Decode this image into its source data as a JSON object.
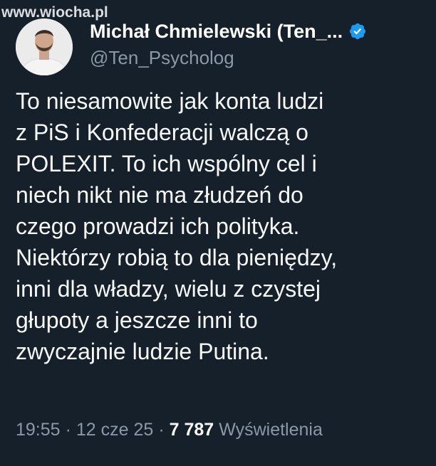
{
  "watermark": "www.wiocha.pl",
  "author": {
    "display_name": "Michał Chmielewski (Ten_...",
    "handle": "@Ten_Psycholog",
    "verified_icon": "verified-badge-icon"
  },
  "tweet": {
    "lines": [
      "To niesamowite jak konta ludzi",
      "z PiS i Konfederacji walczą o",
      "POLEXIT. To ich wspólny cel i",
      "niech nikt nie ma złudzeń do",
      "czego prowadzi ich polityka.",
      "Niektórzy robią to dla pieniędzy,",
      "inni dla władzy, wielu z czystej",
      "głupoty a jeszcze inni to",
      "zwyczajnie ludzie Putina."
    ]
  },
  "meta": {
    "time": "19:55",
    "separator": "·",
    "date": "12 cze 25",
    "views_count": "7 787",
    "views_label": "Wyświetlenia"
  },
  "colors": {
    "background": "#15202b",
    "text": "#f7f9f9",
    "secondary": "#8b98a5",
    "verified": "#1d9bf0"
  }
}
